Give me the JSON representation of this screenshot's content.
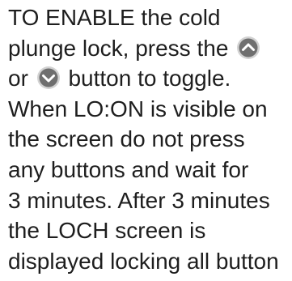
{
  "instruction": {
    "line1": "TO ENABLE the cold",
    "line2": "plunge lock, press the",
    "line3_pre": "or",
    "line3_post": "button to toggle.",
    "line4": "When LO:ON is visible on",
    "line5": "the screen do not press",
    "line6": "any buttons and wait for",
    "line7": "3 minutes. After 3 minutes",
    "line8": "the LOCH screen is",
    "line9": "displayed locking all button"
  },
  "icons": {
    "up": "chevron-up-button-icon",
    "down": "chevron-down-button-icon"
  },
  "colors": {
    "text": "#1e1e1e",
    "button_fill": "#6f6f6f",
    "button_ring": "#b9b9b9"
  }
}
